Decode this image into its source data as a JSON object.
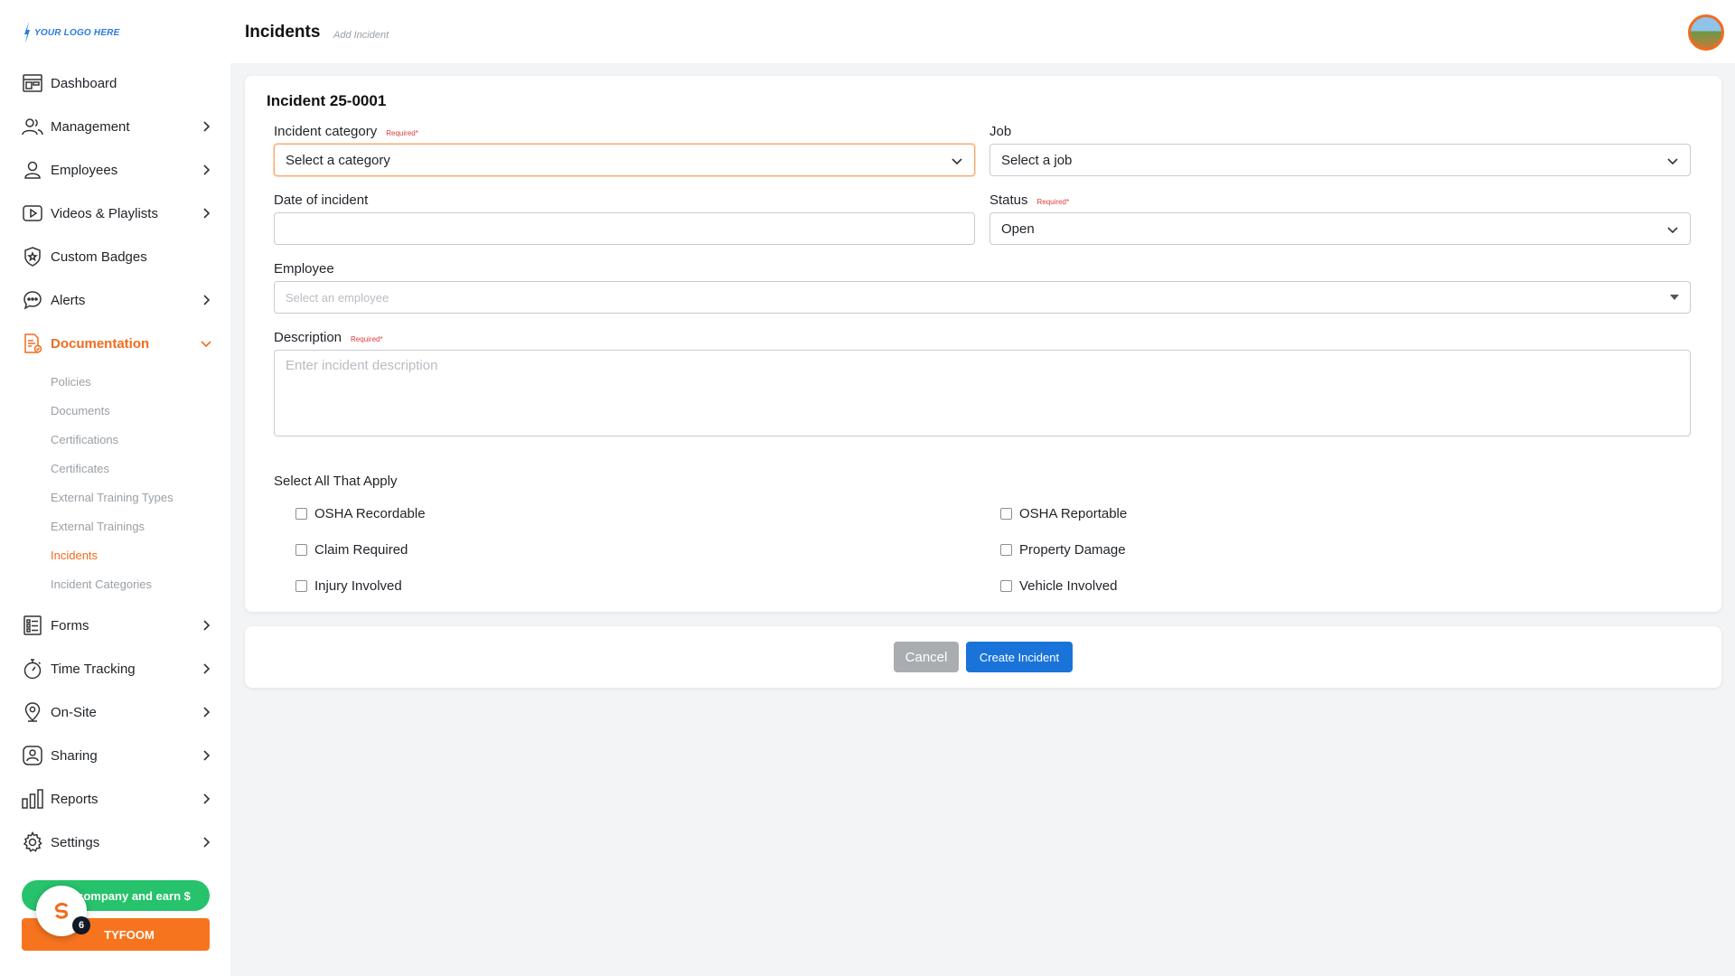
{
  "brand": {
    "logo_text": "YOUR LOGO HERE",
    "accent": "#f26b1d",
    "primary": "#1a73d9"
  },
  "sidebar": {
    "items": [
      {
        "label": "Dashboard",
        "icon": "dashboard-icon",
        "chevron": false
      },
      {
        "label": "Management",
        "icon": "users-icon",
        "chevron": true
      },
      {
        "label": "Employees",
        "icon": "user-icon",
        "chevron": true
      },
      {
        "label": "Videos & Playlists",
        "icon": "play-icon",
        "chevron": true
      },
      {
        "label": "Custom Badges",
        "icon": "badge-icon",
        "chevron": false
      },
      {
        "label": "Alerts",
        "icon": "chat-icon",
        "chevron": true
      },
      {
        "label": "Documentation",
        "icon": "document-icon",
        "chevron": true,
        "active": true
      }
    ],
    "documentation_sub": [
      "Policies",
      "Documents",
      "Certifications",
      "Certificates",
      "External Training Types",
      "External Trainings",
      "Incidents",
      "Incident Categories"
    ],
    "active_sub": "Incidents",
    "items_after": [
      {
        "label": "Forms",
        "icon": "list-icon"
      },
      {
        "label": "Time Tracking",
        "icon": "stopwatch-icon"
      },
      {
        "label": "On-Site",
        "icon": "location-pin-icon"
      },
      {
        "label": "Sharing",
        "icon": "share-icon"
      },
      {
        "label": "Reports",
        "icon": "bar-chart-icon"
      },
      {
        "label": "Settings",
        "icon": "gear-icon"
      }
    ],
    "promo_label": "company and earn $",
    "brand_button_label": "TYFOOM",
    "chat_badge_count": "6"
  },
  "header": {
    "title": "Incidents",
    "subtitle": "Add Incident"
  },
  "form": {
    "title": "Incident 25-0001",
    "required_tag": "Required*",
    "category": {
      "label": "Incident category",
      "value": "Select a category"
    },
    "job": {
      "label": "Job",
      "value": "Select a job"
    },
    "date": {
      "label": "Date of incident",
      "value": ""
    },
    "status": {
      "label": "Status",
      "value": "Open"
    },
    "employee": {
      "label": "Employee",
      "placeholder": "Select an employee"
    },
    "description": {
      "label": "Description",
      "placeholder": "Enter incident description"
    },
    "apply_label": "Select All That Apply",
    "checks": [
      {
        "label": "OSHA Recordable",
        "checked": false
      },
      {
        "label": "OSHA Reportable",
        "checked": false
      },
      {
        "label": "Claim Required",
        "checked": false
      },
      {
        "label": "Property Damage",
        "checked": false
      },
      {
        "label": "Injury Involved",
        "checked": false
      },
      {
        "label": "Vehicle Involved",
        "checked": false
      }
    ]
  },
  "actions": {
    "cancel_label": "Cancel",
    "create_label": "Create Incident"
  }
}
